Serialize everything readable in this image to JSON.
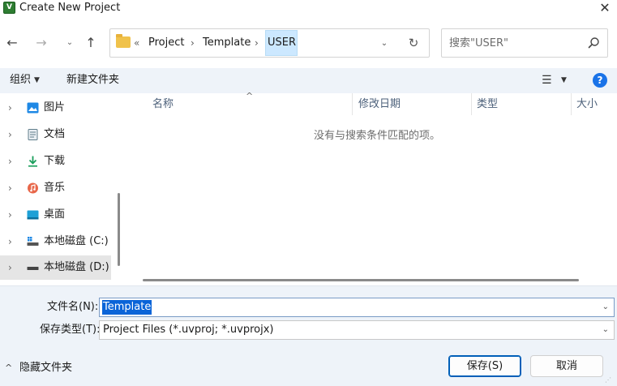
{
  "window": {
    "title": "Create New Project",
    "app_icon_letter": "V",
    "close_glyph": "✕"
  },
  "nav": {
    "back_glyph": "←",
    "forward_glyph": "→",
    "recent_glyph": "⌄",
    "up_glyph": "↑"
  },
  "address": {
    "overflow_glyph": "«",
    "breadcrumb": [
      "Project",
      "Template",
      "USER"
    ],
    "separator": "›",
    "dropdown_glyph": "⌄",
    "refresh_glyph": "↻"
  },
  "search": {
    "placeholder": "搜索\"USER\""
  },
  "toolbar": {
    "organize_label": "组织",
    "organize_arrow": "▼",
    "new_folder_label": "新建文件夹",
    "view_glyph": "☰",
    "view_arrow": "▼",
    "help_glyph": "?"
  },
  "sidebar": {
    "chevron": "›",
    "items": [
      {
        "label": "图片",
        "icon": "pictures-icon",
        "color": "#1e88e5"
      },
      {
        "label": "文档",
        "icon": "documents-icon",
        "color": "#607d8b"
      },
      {
        "label": "下载",
        "icon": "downloads-icon",
        "color": "#1a9e5b"
      },
      {
        "label": "音乐",
        "icon": "music-icon",
        "color": "#e8674a"
      },
      {
        "label": "桌面",
        "icon": "desktop-icon",
        "color": "#1ea0d6"
      },
      {
        "label": "本地磁盘 (C:)",
        "icon": "drive-c-icon",
        "color": "#555555"
      },
      {
        "label": "本地磁盘 (D:)",
        "icon": "drive-d-icon",
        "color": "#555555"
      }
    ],
    "selected_label": "本地磁盘 (D:)"
  },
  "filelist": {
    "columns": [
      "名称",
      "修改日期",
      "类型",
      "大小"
    ],
    "sort_glyph": "^",
    "empty_message": "没有与搜索条件匹配的项。"
  },
  "form": {
    "filename_label": "文件名(N):",
    "filename_value": "Template",
    "filetype_label": "保存类型(T):",
    "filetype_value": "Project Files (*.uvproj; *.uvprojx)",
    "combo_arrow": "⌄"
  },
  "footer": {
    "hide_folders_chevron": "^",
    "hide_folders_label": "隐藏文件夹",
    "save_label": "保存(S)",
    "cancel_label": "取消",
    "grip": "⋰"
  },
  "colors": {
    "accent": "#005fb8",
    "selection": "#0a64d8",
    "toolbar_bg": "#eef3f9",
    "crumb_highlight": "#cce8ff"
  }
}
